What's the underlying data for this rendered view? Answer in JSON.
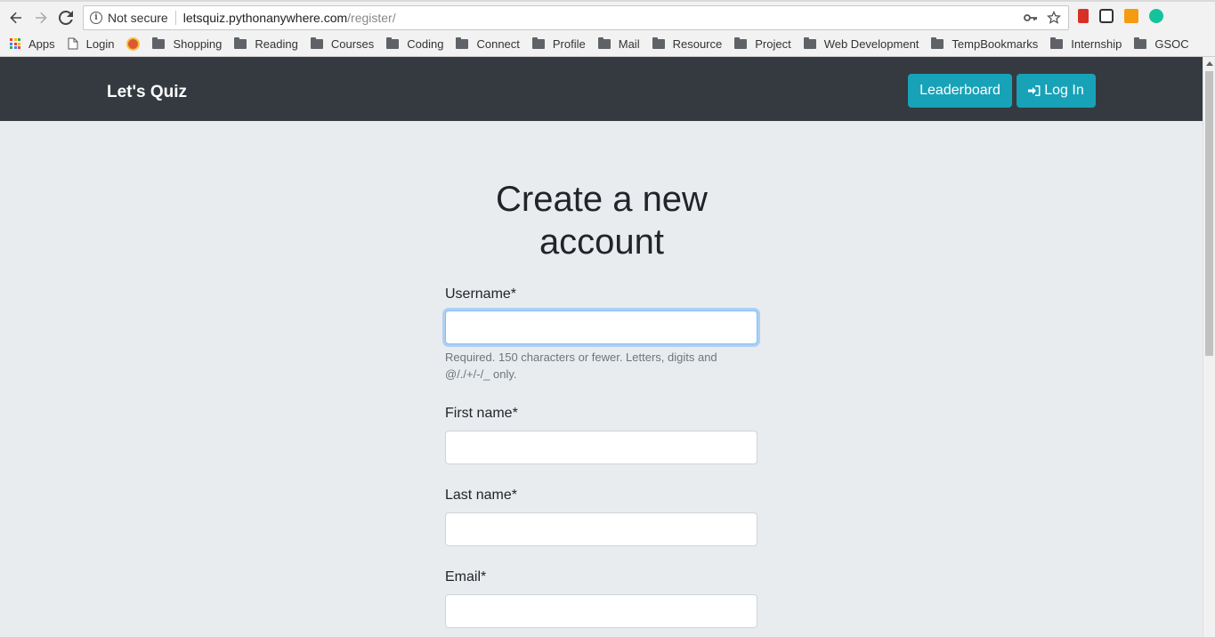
{
  "browser": {
    "security_label": "Not secure",
    "url_host": "letsquiz.pythonanywhere.com",
    "url_path": "/register/",
    "bookmarks": [
      "Apps",
      "Login",
      "Shopping",
      "Reading",
      "Courses",
      "Coding",
      "Connect",
      "Profile",
      "Mail",
      "Resource",
      "Project",
      "Web Development",
      "TempBookmarks",
      "Internship",
      "GSOC"
    ]
  },
  "navbar": {
    "brand": "Let's Quiz",
    "leaderboard_label": "Leaderboard",
    "login_label": "Log In",
    "accent_color": "#17a2b8",
    "background_color": "#343a40"
  },
  "form": {
    "title": "Create a new account",
    "username_label": "Username*",
    "username_help": "Required. 150 characters or fewer. Letters, digits and @/./+/-/_ only.",
    "first_name_label": "First name*",
    "last_name_label": "Last name*",
    "email_label": "Email*"
  }
}
